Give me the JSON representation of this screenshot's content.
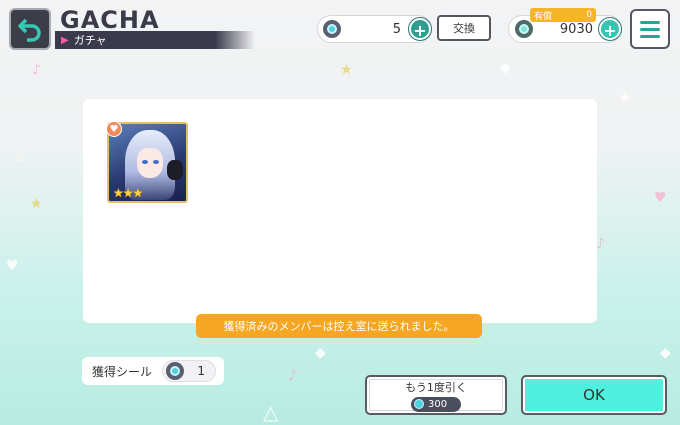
{
  "header": {
    "title_en": "GACHA",
    "title_ja": "ガチャ"
  },
  "currency": {
    "free_gems": "5",
    "exchange_label": "交換",
    "paid_label": "有償",
    "paid_amount": "0",
    "total_gems": "9030"
  },
  "result": {
    "card_stars": "★★★",
    "notice": "獲得済みのメンバーは控え室に送られました。"
  },
  "seal": {
    "label": "獲得シール",
    "count": "1"
  },
  "actions": {
    "again_label": "もう1度引く",
    "again_cost": "300",
    "ok_label": "OK"
  },
  "colors": {
    "accent": "#2f9e8f",
    "notice": "#f5a623",
    "ok_button": "#4ff0dd",
    "dark": "#3a3a4c"
  }
}
